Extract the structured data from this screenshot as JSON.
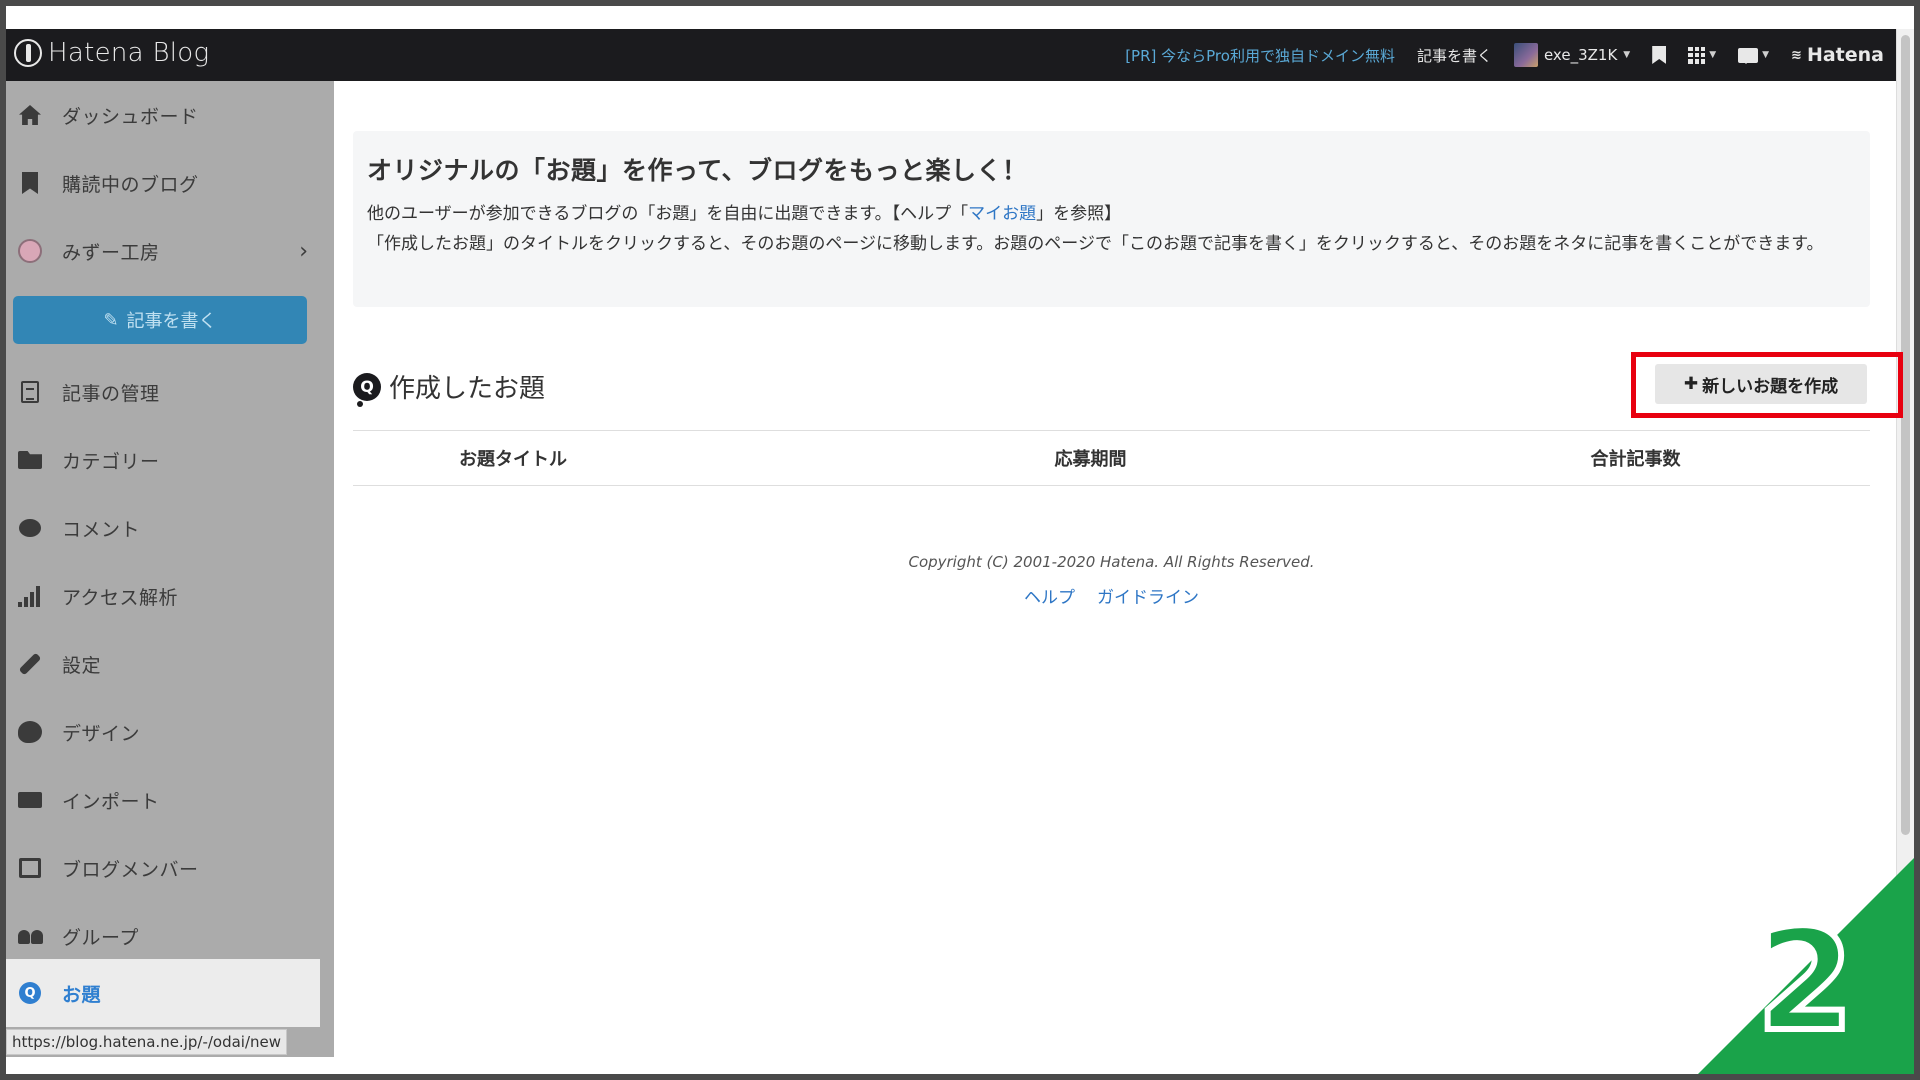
{
  "header": {
    "logo_text": "Hatena Blog",
    "pr_link": "[PR] 今ならPro利用で独自ドメイン無料",
    "write_link": "記事を書く",
    "username": "exe_3Z1K",
    "brand": "Hatena"
  },
  "sidebar": {
    "items": [
      {
        "label": "ダッシュボード",
        "icon": "home-icon"
      },
      {
        "label": "購読中のブログ",
        "icon": "bookmark-icon"
      },
      {
        "label": "みずー工房",
        "icon": "blog-avatar-icon"
      },
      {
        "label": "記事の管理",
        "icon": "document-icon"
      },
      {
        "label": "カテゴリー",
        "icon": "folder-icon"
      },
      {
        "label": "コメント",
        "icon": "comment-icon"
      },
      {
        "label": "アクセス解析",
        "icon": "bar-chart-icon"
      },
      {
        "label": "設定",
        "icon": "wrench-icon"
      },
      {
        "label": "デザイン",
        "icon": "palette-icon"
      },
      {
        "label": "インポート",
        "icon": "truck-icon"
      },
      {
        "label": "ブログメンバー",
        "icon": "member-icon"
      },
      {
        "label": "グループ",
        "icon": "group-icon"
      },
      {
        "label": "お題",
        "icon": "odai-icon"
      }
    ],
    "write_button": "記事を書く",
    "status_url": "https://blog.hatena.ne.jp/-/odai/new"
  },
  "intro": {
    "title": "オリジナルの「お題」を作って、ブログをもっと楽しく！",
    "line1_prefix": "他のユーザーが参加できるブログの「お題」を自由に出題できます。【ヘルプ「",
    "line1_link": "マイお題",
    "line1_suffix": "」を参照】",
    "line2": "「作成したお題」のタイトルをクリックすると、そのお題のページに移動します。お題のページで「このお題で記事を書く」をクリックすると、そのお題をネタに記事を書くことができます。"
  },
  "section": {
    "title": "作成したお題",
    "create_button": "新しいお題を作成"
  },
  "table": {
    "headers": [
      "お題タイトル",
      "応募期間",
      "合計記事数"
    ]
  },
  "footer": {
    "copyright": "Copyright (C) 2001-2020 Hatena. All Rights Reserved.",
    "links": [
      "ヘルプ",
      "ガイドライン"
    ]
  },
  "badge": {
    "step": "2"
  },
  "colors": {
    "header_bg": "#1b1b1e",
    "accent_blue": "#2e76c5",
    "highlight_red": "#e8000f",
    "badge_green": "#1aa34a"
  }
}
